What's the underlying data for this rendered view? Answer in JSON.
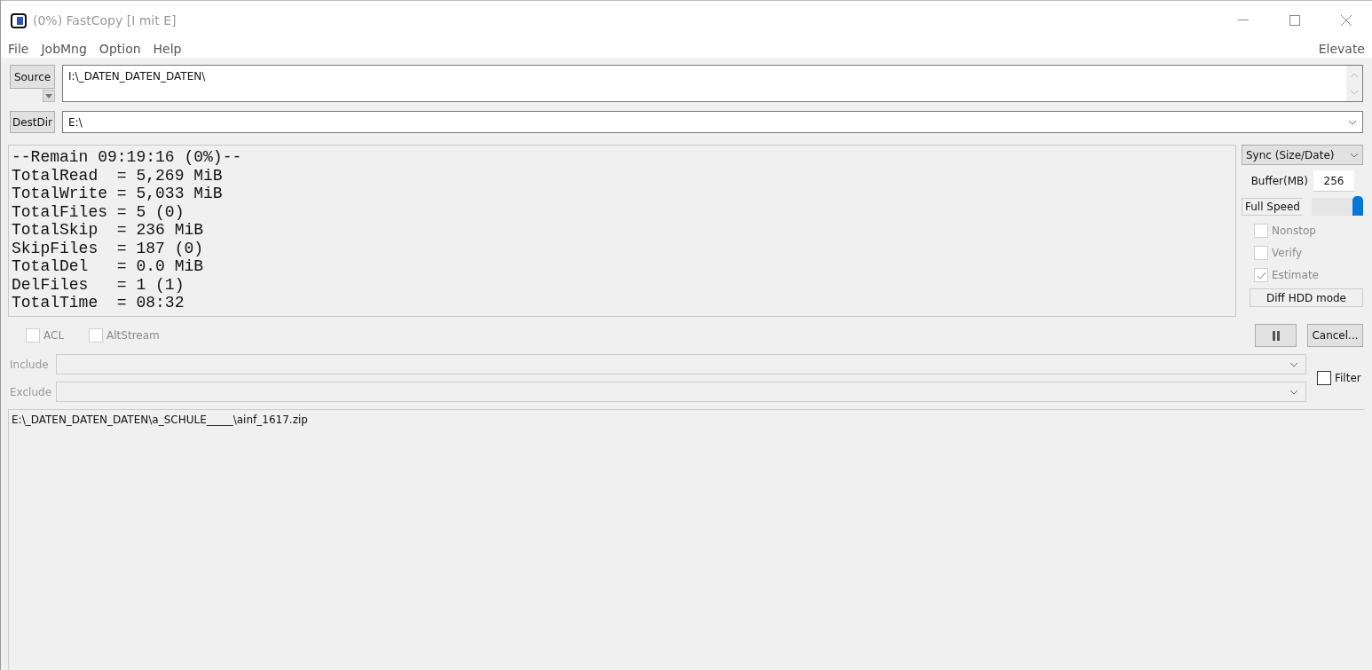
{
  "window": {
    "title": "(0%) FastCopy [I mit E]"
  },
  "menu": [
    {
      "label": "File"
    },
    {
      "label": "JobMng"
    },
    {
      "label": "Option"
    },
    {
      "label": "Help"
    }
  ],
  "elevate": "Elevate",
  "source": {
    "button": "Source",
    "value": "I:\\_DATEN_DATEN_DATEN\\"
  },
  "dest": {
    "button": "DestDir",
    "value": "E:\\"
  },
  "stats": [
    "--Remain 09:19:16 (0%)--",
    "TotalRead  = 5,269 MiB",
    "TotalWrite = 5,033 MiB",
    "TotalFiles = 5 (0)",
    "TotalSkip  = 236 MiB",
    "SkipFiles  = 187 (0)",
    "TotalDel   = 0.0 MiB",
    "DelFiles   = 1 (1)",
    "TotalTime  = 08:32"
  ],
  "mode": "Sync (Size/Date)",
  "buffer": {
    "label": "Buffer(MB)",
    "value": "256"
  },
  "speed": {
    "label": "Full Speed",
    "level": 1.0
  },
  "options": [
    {
      "label": "Nonstop",
      "checked": false,
      "disabled": true
    },
    {
      "label": "Verify",
      "checked": false,
      "disabled": true
    },
    {
      "label": "Estimate",
      "checked": true,
      "disabled": true
    }
  ],
  "diff_mode": "Diff HDD mode",
  "cancel": "Cancel...",
  "extra_options": [
    {
      "label": "ACL",
      "checked": false
    },
    {
      "label": "AltStream",
      "checked": false
    }
  ],
  "include": {
    "label": "Include"
  },
  "exclude": {
    "label": "Exclude"
  },
  "filter": {
    "label": "Filter",
    "checked": false
  },
  "log": [
    "E:\\_DATEN_DATEN_DATEN\\a_SCHULE_____\\ainf_1617.zip"
  ]
}
